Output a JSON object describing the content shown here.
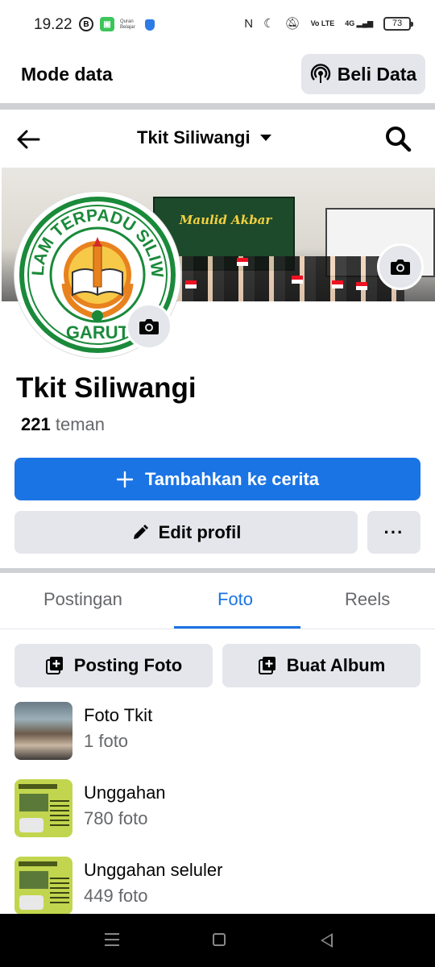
{
  "status_bar": {
    "time": "19.22",
    "b_badge": "B",
    "app_badge": "Quran Belajar",
    "network": "4G",
    "volte": "Vo LTE",
    "battery": "73"
  },
  "mode_bar": {
    "title": "Mode data",
    "button_label": "Beli Data"
  },
  "header": {
    "title": "Tkit Siliwangi"
  },
  "cover": {
    "banner_title": "Maulid Akbar"
  },
  "logo": {
    "text_top": "TK ISLAM TERPADU SILIWANGI",
    "text_bottom": "GARUT"
  },
  "profile": {
    "name": "Tkit Siliwangi",
    "friends_count": "221",
    "friends_label": "teman"
  },
  "buttons": {
    "add_story": "Tambahkan ke cerita",
    "edit_profile": "Edit profil",
    "more": "···"
  },
  "tabs": [
    {
      "label": "Postingan",
      "active": false
    },
    {
      "label": "Foto",
      "active": true
    },
    {
      "label": "Reels",
      "active": false
    }
  ],
  "photo_actions": {
    "posting": "Posting Foto",
    "album": "Buat Album"
  },
  "albums": [
    {
      "name": "Foto Tkit",
      "count": "1 foto"
    },
    {
      "name": "Unggahan",
      "count": "780 foto"
    },
    {
      "name": "Unggahan seluler",
      "count": "449 foto"
    }
  ],
  "colors": {
    "accent": "#1b74e4",
    "button_gray": "#e4e6eb",
    "secondary_text": "#65676b",
    "logo_green": "#1a8a3a",
    "logo_orange": "#e8821e"
  }
}
